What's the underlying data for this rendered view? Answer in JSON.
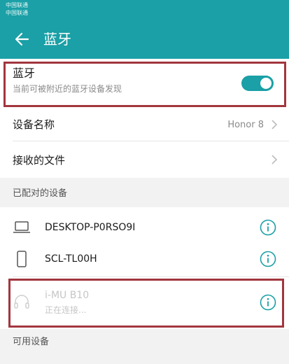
{
  "status_bar": {
    "carrier_line1": "中国联通",
    "carrier_line2": "中国联通"
  },
  "header": {
    "title": "蓝牙"
  },
  "bluetooth": {
    "title": "蓝牙",
    "subtitle": "当前可被附近的蓝牙设备发现",
    "enabled": true
  },
  "device_name": {
    "label": "设备名称",
    "value": "Honor 8"
  },
  "received_files": {
    "label": "接收的文件"
  },
  "paired_section": {
    "label": "已配对的设备",
    "devices": [
      {
        "name": "DESKTOP-P0RSO9I",
        "icon": "laptop-icon",
        "status": ""
      },
      {
        "name": "SCL-TL00H",
        "icon": "phone-icon",
        "status": ""
      },
      {
        "name": "i-MU B10",
        "icon": "headphones-icon",
        "status": "正在连接..."
      }
    ]
  },
  "available_section": {
    "label": "可用设备"
  },
  "colors": {
    "accent": "#1aa0a6",
    "highlight": "#a2363e"
  }
}
